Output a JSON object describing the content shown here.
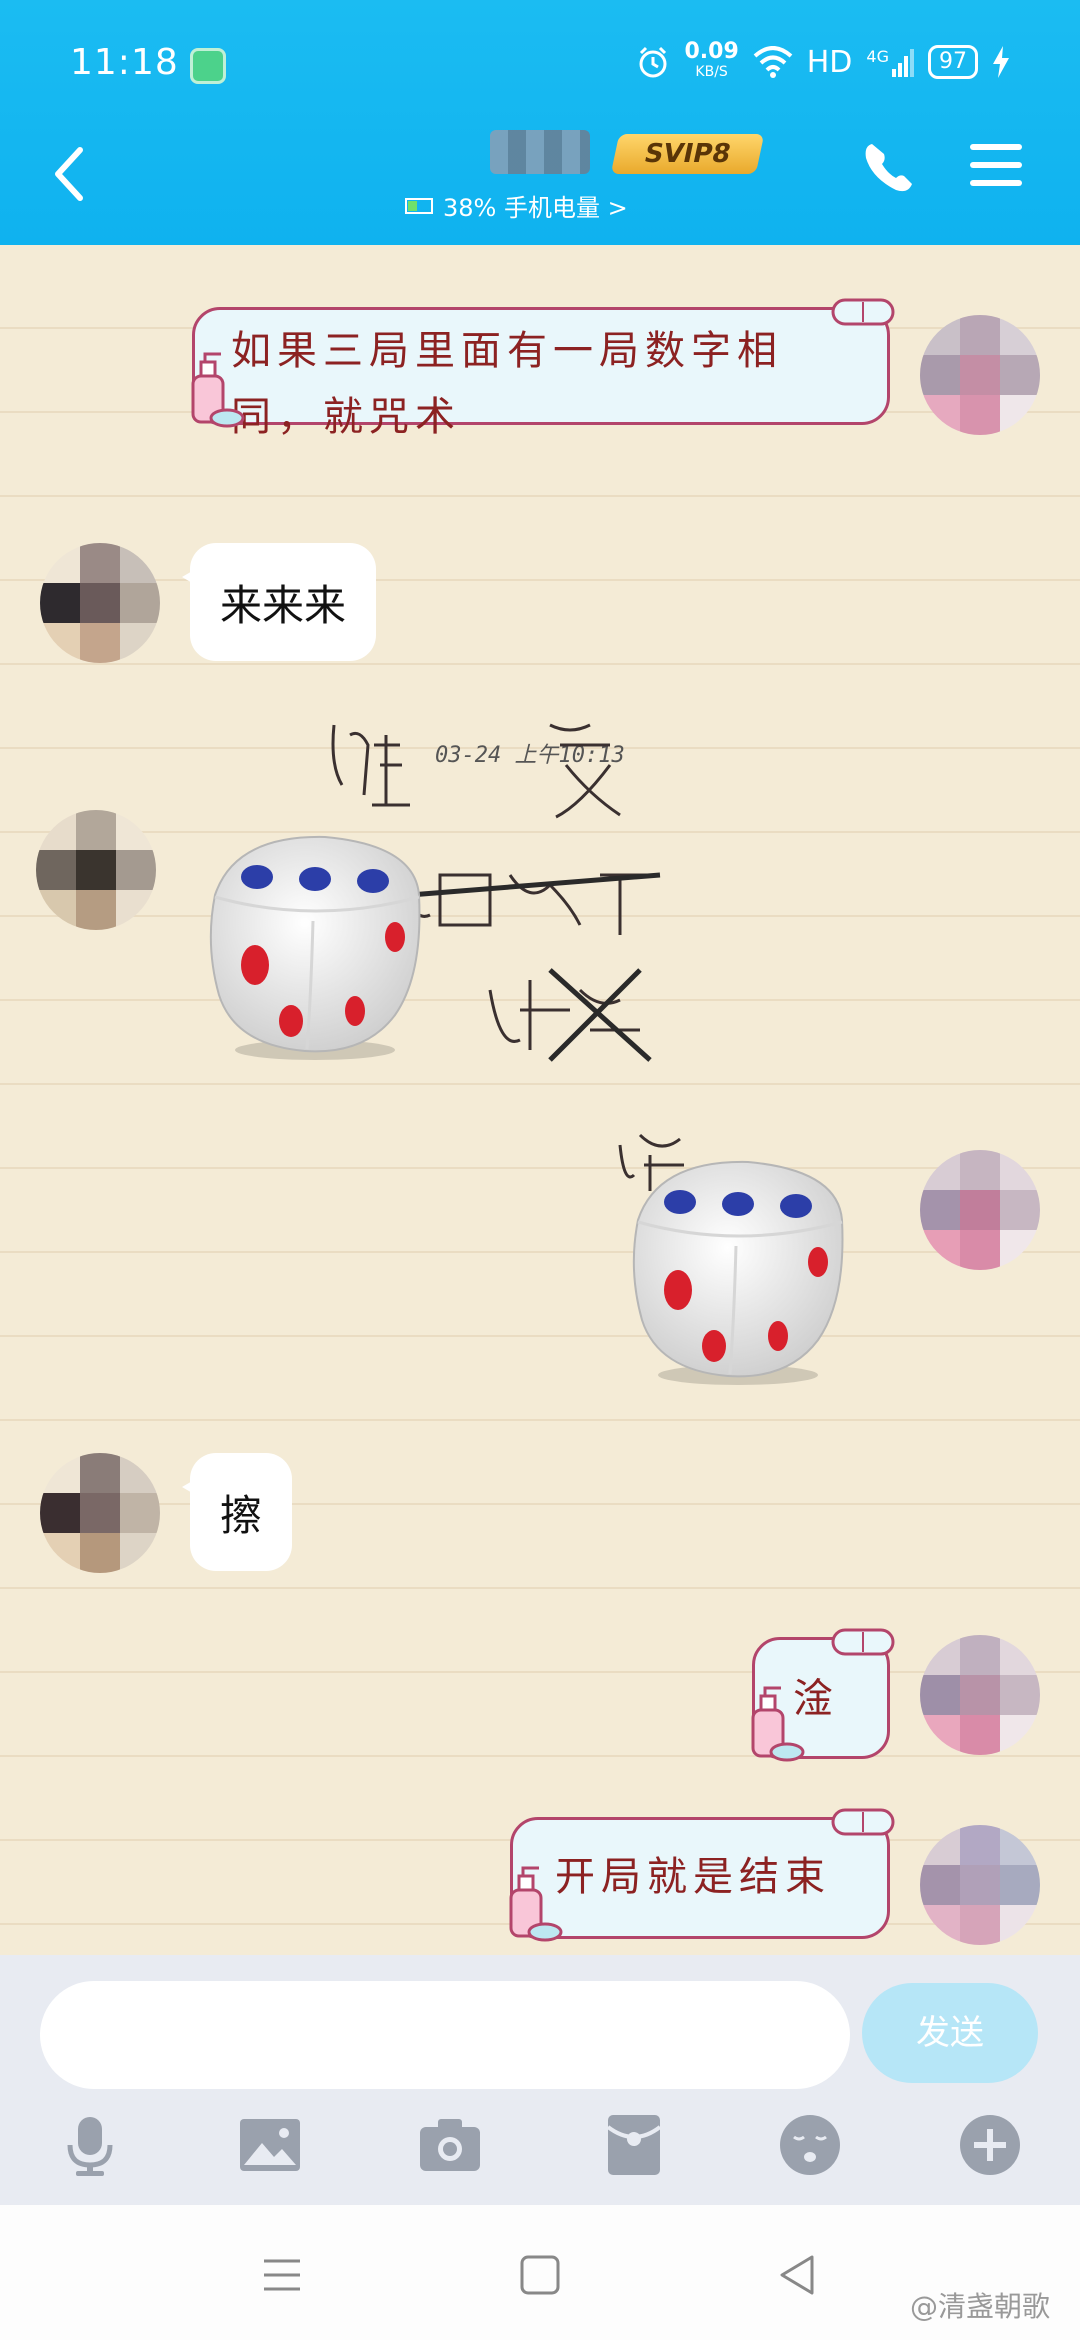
{
  "status_bar": {
    "time": "11:18",
    "net_speed": "0.09",
    "net_speed_unit": "KB/S",
    "hd": "HD",
    "signal": "4G",
    "battery": "97"
  },
  "header": {
    "svip": "SVIP8",
    "phone_status": "38% 手机电量 >",
    "icons": [
      "back-icon",
      "call-icon",
      "menu-icon"
    ]
  },
  "messages": [
    {
      "side": "right",
      "style": "deco",
      "text_lines": [
        "如果三局里面有一局数字相",
        "同，就咒术"
      ]
    },
    {
      "side": "left",
      "style": "white",
      "text": "来来来"
    },
    {
      "type": "timestamp",
      "text": "03-24 上午10:13"
    },
    {
      "side": "left",
      "style": "dice",
      "dice_value": 3
    },
    {
      "side": "right",
      "style": "dice",
      "dice_value": 3
    },
    {
      "side": "left",
      "style": "white",
      "text": "擦"
    },
    {
      "side": "right",
      "style": "deco",
      "text": "淦"
    },
    {
      "side": "right",
      "style": "deco",
      "text": "开局就是结束"
    }
  ],
  "input": {
    "value": "",
    "send_label": "发送"
  },
  "toolbar": [
    "mic-icon",
    "image-icon",
    "camera-icon",
    "red-packet-icon",
    "emoji-icon",
    "plus-icon"
  ],
  "system_nav": [
    "menu-nav-icon",
    "home-nav-icon",
    "back-nav-icon"
  ],
  "watermark": "@清盏朝歌",
  "colors": {
    "header": "#10b3ef",
    "chat_bg": "#f4ebd6",
    "deco_text": "#8c2222",
    "deco_border": "#b3456b",
    "send_button": "#b6e6f7"
  }
}
